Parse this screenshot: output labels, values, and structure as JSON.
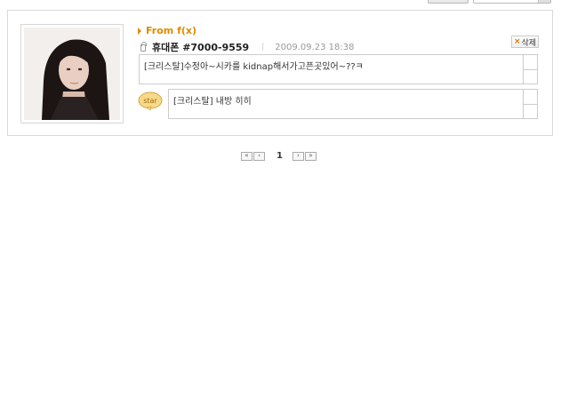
{
  "card": {
    "from_label": "From f(x)",
    "phone": "휴대폰 #7000-9559",
    "datetime": "2009.09.23 18:38",
    "delete_label": "삭제",
    "message": "[크리스탈]수정아~시카를 kidnap해서가고픈곳있어~??ㅋ",
    "reply_badge": "star",
    "reply": "[크리스탈] 내방 히히"
  },
  "pagination": {
    "current_page": "1"
  },
  "colors": {
    "accent": "#e08a00",
    "border": "#d9d9d9",
    "badge_fill": "#f6d98a"
  }
}
